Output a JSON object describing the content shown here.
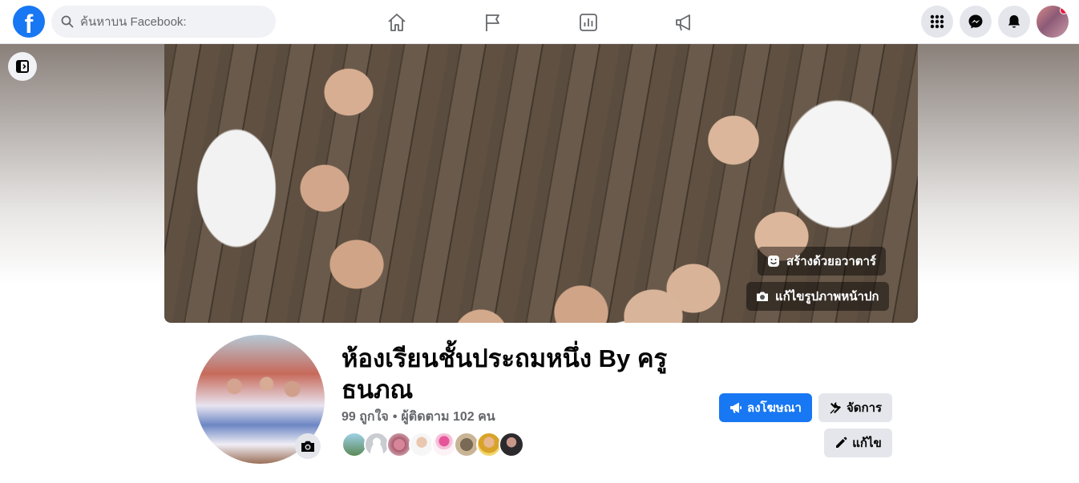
{
  "header": {
    "logo_letter": "f",
    "search_placeholder": "ค้นหาบน Facebook:",
    "nav_icons": [
      "home-icon",
      "flag-icon",
      "chart-icon",
      "megaphone-icon"
    ],
    "right_icons": [
      "menu-grid-icon",
      "messenger-icon",
      "bell-icon"
    ],
    "notification_dot_color": "#e41e3f"
  },
  "cover": {
    "avatar_button_label": "สร้างด้วยอวาตาร์",
    "edit_cover_label": "แก้ไขรูปภาพหน้าปก"
  },
  "page": {
    "title": "ห้องเรียนชั้นประถมหนึ่ง By ครูธนภณ",
    "likes": "99 ถูกใจ",
    "separator": "•",
    "followers": "ผู้ติดตาม 102 คน",
    "follower_avatar_count": 8
  },
  "actions": {
    "promote_label": "ลงโฆษณา",
    "manage_label": "จัดการ",
    "edit_label": "แก้ไข"
  },
  "colors": {
    "brand": "#1877f2",
    "button_secondary": "#e4e6eb",
    "text_secondary": "#65676b"
  }
}
